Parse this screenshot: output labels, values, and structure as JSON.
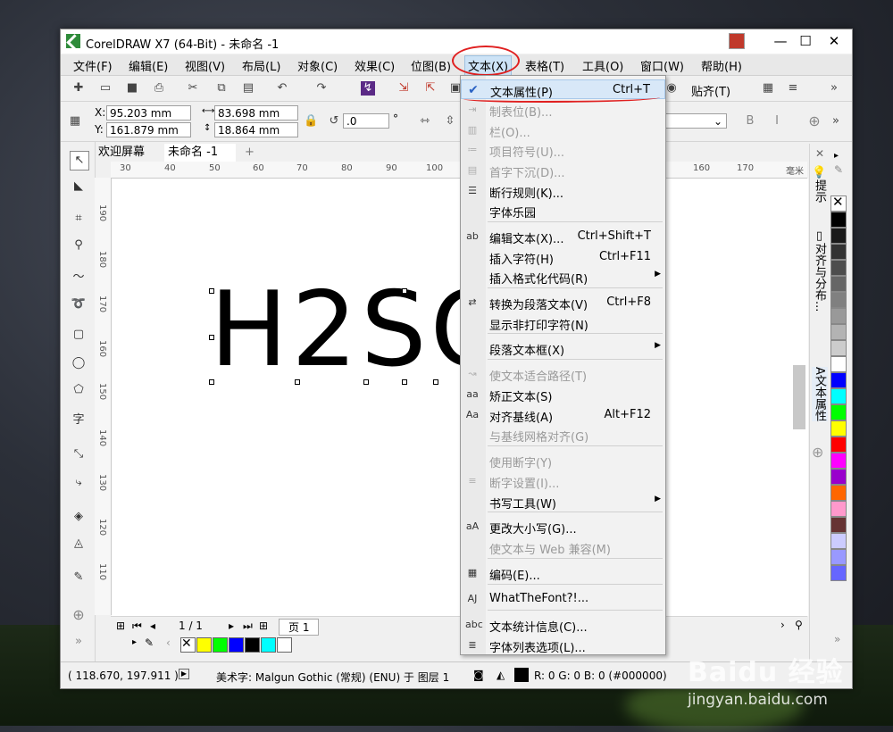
{
  "window": {
    "title": "CorelDRAW X7 (64-Bit) - 未命名 -1",
    "minimize": "—",
    "maximize": "☐",
    "close": "✕"
  },
  "menubar": [
    "文件(F)",
    "编辑(E)",
    "视图(V)",
    "布局(L)",
    "对象(C)",
    "效果(C)",
    "位图(B)",
    "文本(X)",
    "表格(T)",
    "工具(O)",
    "窗口(W)",
    "帮助(H)"
  ],
  "toolbar": {
    "snap_label": "贴齐(T)",
    "font_partial": "pt"
  },
  "propbar": {
    "x_label": "X:",
    "x_value": "95.203 mm",
    "y_label": "Y:",
    "y_value": "161.879 mm",
    "w_value": "83.698 mm",
    "h_value": "18.864 mm",
    "angle_value": ".0",
    "angle_unit": "°"
  },
  "tabs": {
    "welcome": "欢迎屏幕",
    "doc": "未命名 -1",
    "add": "+"
  },
  "ruler": {
    "h_ticks": [
      "30",
      "40",
      "50",
      "60",
      "70",
      "80",
      "90",
      "100",
      "160",
      "170"
    ],
    "unit": "毫米",
    "v_ticks": [
      "190",
      "180",
      "170",
      "160",
      "150",
      "140",
      "130",
      "120",
      "110"
    ]
  },
  "canvas": {
    "text": "H2SO"
  },
  "pagebar": {
    "page_count": "1 / 1",
    "page_tab": "页 1"
  },
  "status": {
    "coords": "( 118.670, 197.911 )",
    "object_info": "美术字: Malgun Gothic (常规) (ENU) 于 图层 1",
    "color_info": "R: 0 G: 0 B: 0 (#000000)"
  },
  "docker": {
    "hints": "提示",
    "align": "对齐与分布...",
    "text_props": "文本属性"
  },
  "text_menu": {
    "items": [
      {
        "label": "文本属性(P)",
        "shortcut": "Ctrl+T",
        "icon": "check-icon",
        "disabled": false,
        "submenu": false
      },
      {
        "label": "制表位(B)...",
        "shortcut": "",
        "icon": "tab-stop-icon",
        "disabled": true,
        "submenu": false
      },
      {
        "label": "栏(O)...",
        "shortcut": "",
        "icon": "columns-icon",
        "disabled": true,
        "submenu": false
      },
      {
        "label": "项目符号(U)...",
        "shortcut": "",
        "icon": "bullets-icon",
        "disabled": true,
        "submenu": false
      },
      {
        "label": "首字下沉(D)...",
        "shortcut": "",
        "icon": "drop-cap-icon",
        "disabled": true,
        "submenu": false
      },
      {
        "label": "断行规则(K)...",
        "shortcut": "",
        "icon": "line-break-icon",
        "disabled": false,
        "submenu": false
      },
      {
        "label": "字体乐园",
        "shortcut": "",
        "icon": "",
        "disabled": false,
        "submenu": false
      },
      {
        "label": "编辑文本(X)...",
        "shortcut": "Ctrl+Shift+T",
        "icon": "edit-text-icon",
        "disabled": false,
        "submenu": false
      },
      {
        "label": "插入字符(H)",
        "shortcut": "Ctrl+F11",
        "icon": "",
        "disabled": false,
        "submenu": false
      },
      {
        "label": "插入格式化代码(R)",
        "shortcut": "",
        "icon": "",
        "disabled": false,
        "submenu": true
      },
      {
        "label": "转换为段落文本(V)",
        "shortcut": "Ctrl+F8",
        "icon": "convert-icon",
        "disabled": false,
        "submenu": false
      },
      {
        "label": "显示非打印字符(N)",
        "shortcut": "",
        "icon": "",
        "disabled": false,
        "submenu": false
      },
      {
        "label": "段落文本框(X)",
        "shortcut": "",
        "icon": "",
        "disabled": false,
        "submenu": true
      },
      {
        "label": "使文本适合路径(T)",
        "shortcut": "",
        "icon": "fit-path-icon",
        "disabled": true,
        "submenu": false
      },
      {
        "label": "矫正文本(S)",
        "shortcut": "",
        "icon": "straighten-icon",
        "disabled": false,
        "submenu": false
      },
      {
        "label": "对齐基线(A)",
        "shortcut": "Alt+F12",
        "icon": "baseline-icon",
        "disabled": false,
        "submenu": false
      },
      {
        "label": "与基线网格对齐(G)",
        "shortcut": "",
        "icon": "",
        "disabled": true,
        "submenu": false
      },
      {
        "label": "使用断字(Y)",
        "shortcut": "",
        "icon": "",
        "disabled": true,
        "submenu": false
      },
      {
        "label": "断字设置(I)...",
        "shortcut": "",
        "icon": "hyphen-icon",
        "disabled": true,
        "submenu": false
      },
      {
        "label": "书写工具(W)",
        "shortcut": "",
        "icon": "",
        "disabled": false,
        "submenu": true
      },
      {
        "label": "更改大小写(G)...",
        "shortcut": "",
        "icon": "case-icon",
        "disabled": false,
        "submenu": false
      },
      {
        "label": "使文本与 Web 兼容(M)",
        "shortcut": "",
        "icon": "",
        "disabled": true,
        "submenu": false
      },
      {
        "label": "编码(E)...",
        "shortcut": "",
        "icon": "encode-icon",
        "disabled": false,
        "submenu": false
      },
      {
        "label": "WhatTheFont?!...",
        "shortcut": "",
        "icon": "whatthefont-icon",
        "disabled": false,
        "submenu": false
      },
      {
        "label": "文本统计信息(C)...",
        "shortcut": "",
        "icon": "stats-icon",
        "disabled": false,
        "submenu": false
      },
      {
        "label": "字体列表选项(L)...",
        "shortcut": "",
        "icon": "font-list-icon",
        "disabled": false,
        "submenu": false
      }
    ]
  },
  "palette_colors": [
    "#000000",
    "#1a1a1a",
    "#333333",
    "#4d4d4d",
    "#666666",
    "#808080",
    "#999999",
    "#b3b3b3",
    "#cccccc",
    "#ffffff",
    "#0000ff",
    "#00ffff",
    "#00ff00",
    "#ffff00",
    "#ff0000",
    "#ff00ff",
    "#9900cc",
    "#ff6600",
    "#ff99cc",
    "#663333",
    "#ccccff",
    "#9999ff",
    "#6666ff"
  ],
  "bottom_swatches": [
    "#ffff00",
    "#00ff00",
    "#0000ff",
    "#000000",
    "#00ffff",
    "#ffffff"
  ],
  "watermark": {
    "brand": "Baidu 经验",
    "url": "jingyan.baidu.com"
  }
}
